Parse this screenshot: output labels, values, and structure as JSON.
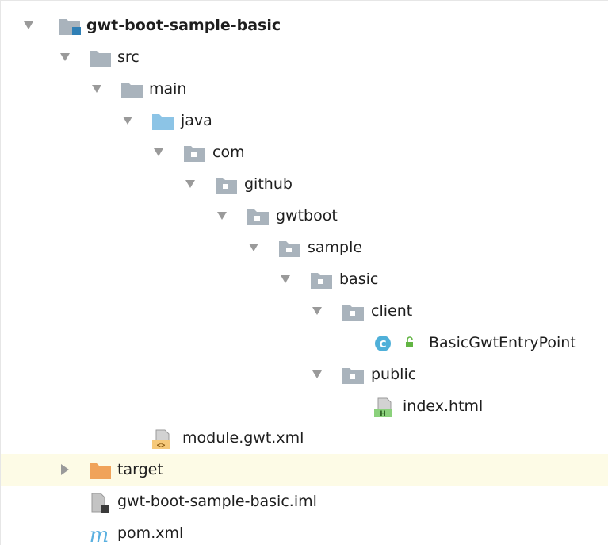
{
  "tree": {
    "root": {
      "label": "gwt-boot-sample-basic"
    },
    "src": {
      "label": "src"
    },
    "main": {
      "label": "main"
    },
    "java": {
      "label": "java"
    },
    "com": {
      "label": "com"
    },
    "github": {
      "label": "github"
    },
    "gwtboot": {
      "label": "gwtboot"
    },
    "sample": {
      "label": "sample"
    },
    "basic": {
      "label": "basic"
    },
    "client": {
      "label": "client"
    },
    "entry_point": {
      "label": "BasicGwtEntryPoint",
      "badge": "C"
    },
    "public": {
      "label": "public"
    },
    "index_html": {
      "label": "index.html",
      "badge": "H"
    },
    "module_gwt": {
      "label": "module.gwt.xml",
      "badge": "<>"
    },
    "target": {
      "label": "target"
    },
    "iml": {
      "label": "gwt-boot-sample-basic.iml"
    },
    "pom": {
      "label": "pom.xml",
      "badge": "m"
    }
  },
  "colors": {
    "folder_gray": "#a9b3bc",
    "folder_blue": "#8cc4e6",
    "folder_orange": "#f0a35a",
    "class_badge": "#4fb0d9",
    "highlight_row": "#fdfbe6",
    "arrow": "#9a9a9a"
  }
}
